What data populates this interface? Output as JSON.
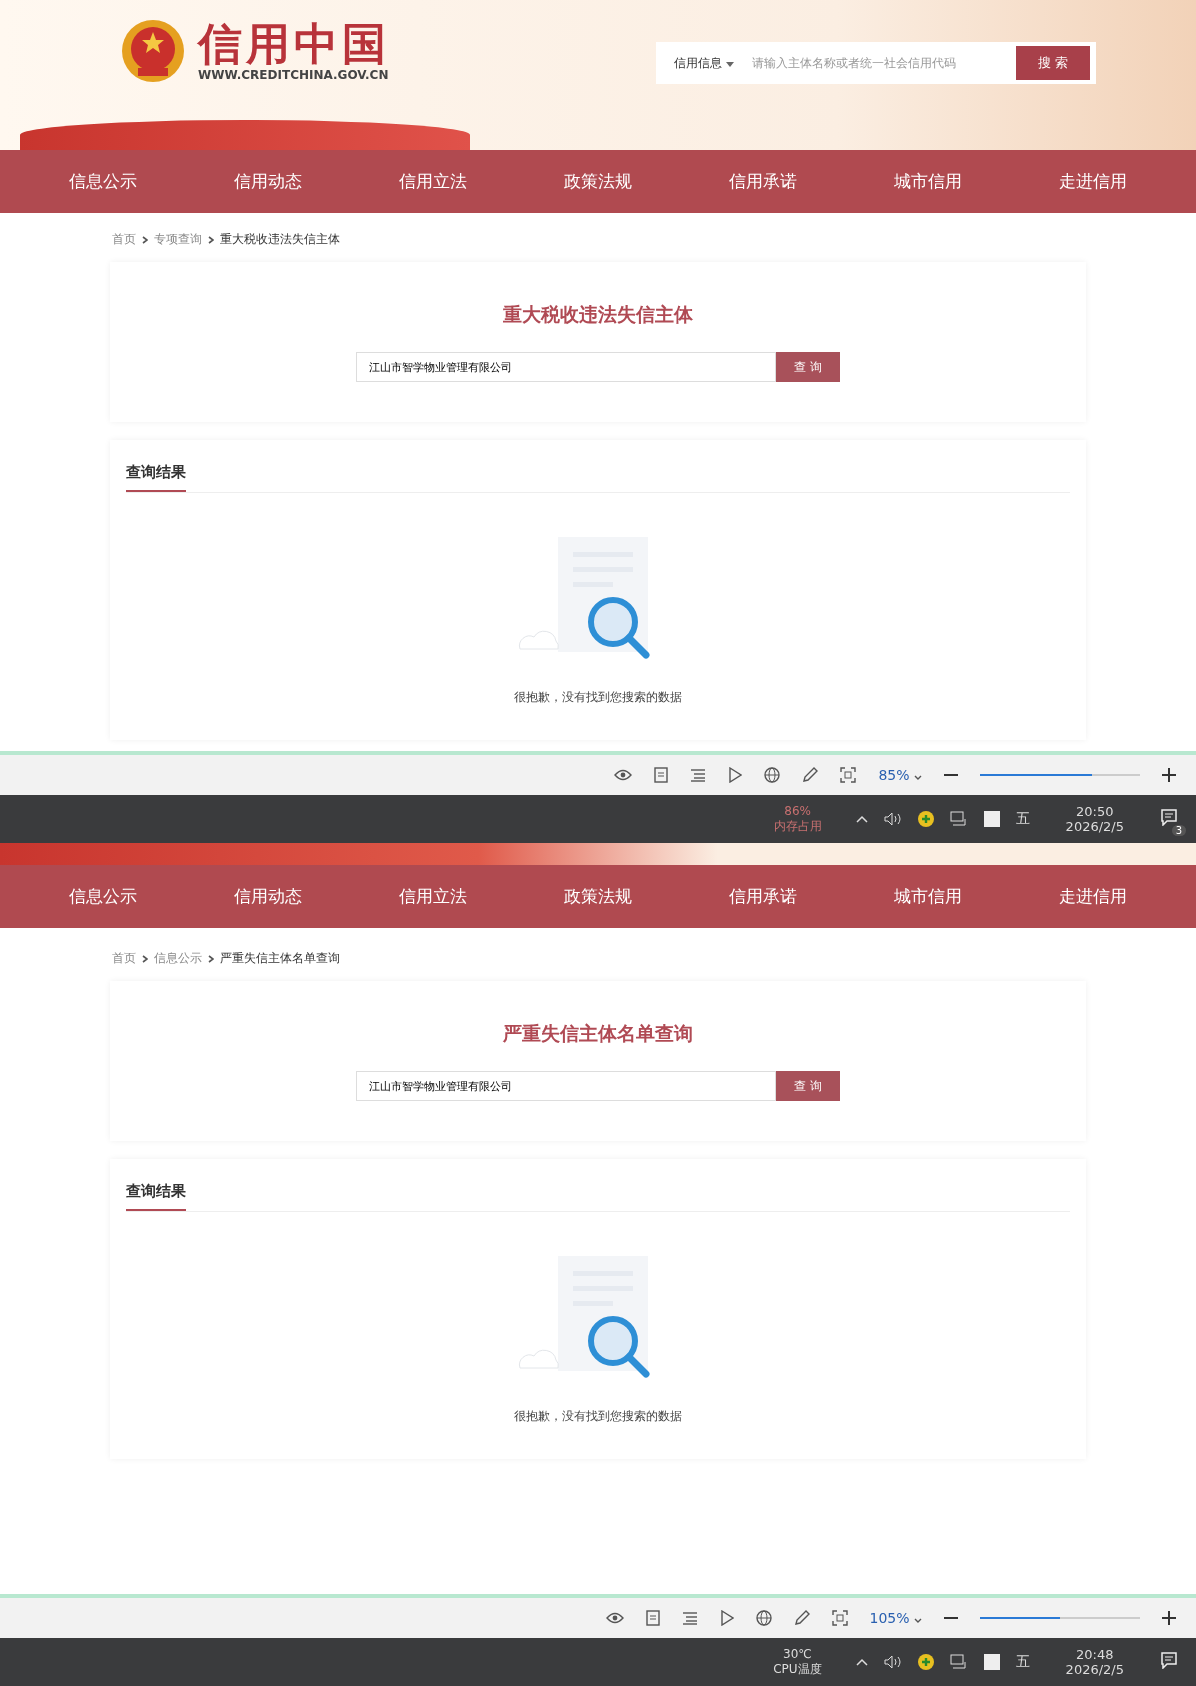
{
  "screens": [
    {
      "header": {
        "logo_title": "信用中国",
        "logo_url": "WWW.CREDITCHINA.GOV.CN",
        "search_category": "信用信息",
        "search_placeholder": "请输入主体名称或者统一社会信用代码",
        "search_button": "搜 索"
      },
      "nav": [
        "信息公示",
        "信用动态",
        "信用立法",
        "政策法规",
        "信用承诺",
        "城市信用",
        "走进信用"
      ],
      "breadcrumb": [
        "首页",
        "专项查询",
        "重大税收违法失信主体"
      ],
      "title": "重大税收违法失信主体",
      "query": "江山市智学物业管理有限公司",
      "query_button": "查 询",
      "result_title": "查询结果",
      "empty_text": "很抱歉，没有找到您搜索的数据",
      "viewer": {
        "zoom": "85%",
        "level": 0.7
      },
      "taskbar": {
        "stat_value": "86%",
        "stat_label": "内存占用",
        "ime": "五",
        "time": "20:50",
        "date": "2026/2/5",
        "badge": "3"
      }
    },
    {
      "nav": [
        "信息公示",
        "信用动态",
        "信用立法",
        "政策法规",
        "信用承诺",
        "城市信用",
        "走进信用"
      ],
      "breadcrumb": [
        "首页",
        "信息公示",
        "严重失信主体名单查询"
      ],
      "title": "严重失信主体名单查询",
      "query": "江山市智学物业管理有限公司",
      "query_button": "查 询",
      "result_title": "查询结果",
      "empty_text": "很抱歉，没有找到您搜索的数据",
      "viewer": {
        "zoom": "105%",
        "level": 0.5
      },
      "taskbar": {
        "stat_value": "30℃",
        "stat_label": "CPU温度",
        "ime": "五",
        "time": "20:48",
        "date": "2026/2/5"
      }
    }
  ]
}
